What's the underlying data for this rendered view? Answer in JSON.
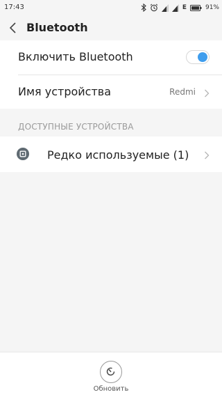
{
  "status_bar": {
    "time": "17:43",
    "network_label": "E",
    "battery": "91%"
  },
  "header": {
    "title": "Bluetooth"
  },
  "settings": {
    "enable_label": "Включить Bluetooth",
    "enable_on": true,
    "device_name_label": "Имя устройства",
    "device_name_value": "Redmi"
  },
  "available": {
    "section_title": "ДОСТУПНЫЕ УСТРОЙСТВА",
    "rarely_used_label": "Редко используемые (1)"
  },
  "bottom": {
    "refresh_label": "Обновить"
  },
  "colors": {
    "accent": "#3f9ded",
    "background": "#f5f5f5"
  }
}
